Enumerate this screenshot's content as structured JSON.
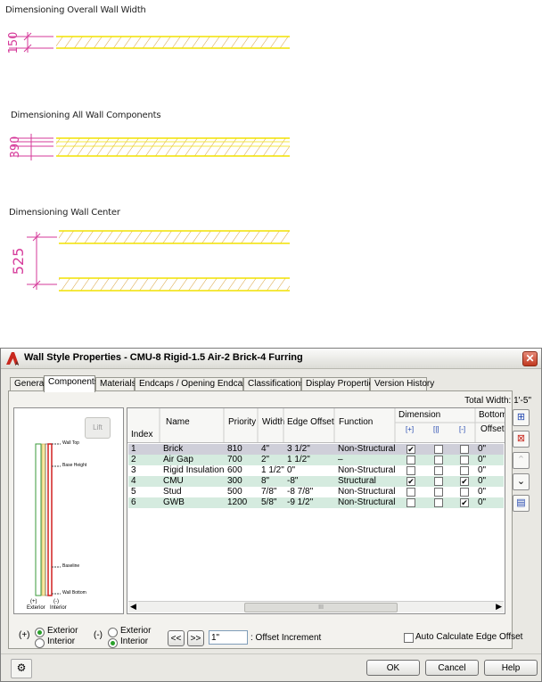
{
  "drawings": {
    "overall": {
      "title": "Dimensioning Overall Wall Width",
      "dim": "150"
    },
    "components": {
      "title": "Dimensioning All Wall Components",
      "dim": "390"
    },
    "center": {
      "title": "Dimensioning Wall Center",
      "dim": "525"
    }
  },
  "dialog": {
    "title": "Wall Style Properties - CMU-8 Rigid-1.5 Air-2 Brick-4 Furring",
    "close_label": "✕",
    "tabs": [
      "General",
      "Components",
      "Materials",
      "Endcaps / Opening Endcaps",
      "Classifications",
      "Display Properties",
      "Version History"
    ],
    "active_tab": "Components",
    "total_width": "Total Width: 1'-5\"",
    "preview": {
      "lift_label": "Lift",
      "labels": {
        "wall_top": "Wall Top",
        "base_height": "Base Height",
        "baseline": "Baseline",
        "wall_bottom": "Wall Bottom"
      },
      "exterior_sign": "(+)",
      "interior_sign": "(-)",
      "exterior": "Exterior",
      "interior": "Interior"
    },
    "grid": {
      "headers": {
        "index": "Index",
        "name": "Name",
        "priority": "Priority",
        "width": "Width",
        "edge_offset": "Edge Offset",
        "function": "Function",
        "dimension": "Dimension",
        "bottom": "Bottom",
        "offset": "Offset"
      },
      "dim_icons": [
        "[+]",
        "[|]",
        "[-]"
      ],
      "rows": [
        {
          "index": "1",
          "name": "Brick",
          "priority": "810",
          "width": "4\"",
          "edge_offset": "3 1/2\"",
          "function": "Non-Structural",
          "d1": "✔",
          "d2": "",
          "d3": "",
          "bottom": "0\""
        },
        {
          "index": "2",
          "name": "Air Gap",
          "priority": "700",
          "width": "2\"",
          "edge_offset": "1 1/2\"",
          "function": "–",
          "d1": "",
          "d2": "",
          "d3": "",
          "bottom": "0\""
        },
        {
          "index": "3",
          "name": "Rigid Insulation",
          "priority": "600",
          "width": "1 1/2\"",
          "edge_offset": "0\"",
          "function": "Non-Structural",
          "d1": "",
          "d2": "",
          "d3": "",
          "bottom": "0\""
        },
        {
          "index": "4",
          "name": "CMU",
          "priority": "300",
          "width": "8\"",
          "edge_offset": "-8\"",
          "function": "Structural",
          "d1": "✔",
          "d2": "",
          "d3": "✔",
          "bottom": "0\""
        },
        {
          "index": "5",
          "name": "Stud",
          "priority": "500",
          "width": "7/8\"",
          "edge_offset": "-8 7/8\"",
          "function": "Non-Structural",
          "d1": "",
          "d2": "",
          "d3": "",
          "bottom": "0\""
        },
        {
          "index": "6",
          "name": "GWB",
          "priority": "1200",
          "width": "5/8\"",
          "edge_offset": "-9 1/2\"",
          "function": "Non-Structural",
          "d1": "",
          "d2": "",
          "d3": "✔",
          "bottom": "0\""
        }
      ],
      "scroll_thumb": "III"
    },
    "bottom": {
      "plus_label": "(+)",
      "minus_label": "(-)",
      "exterior": "Exterior",
      "interior": "Interior",
      "prev_btn": "<<",
      "next_btn": ">>",
      "offset_value": "1\"",
      "offset_label": ": Offset Increment",
      "auto_calc": "Auto Calculate Edge Offset"
    },
    "buttons": {
      "ok": "OK",
      "cancel": "Cancel",
      "help": "Help"
    }
  }
}
